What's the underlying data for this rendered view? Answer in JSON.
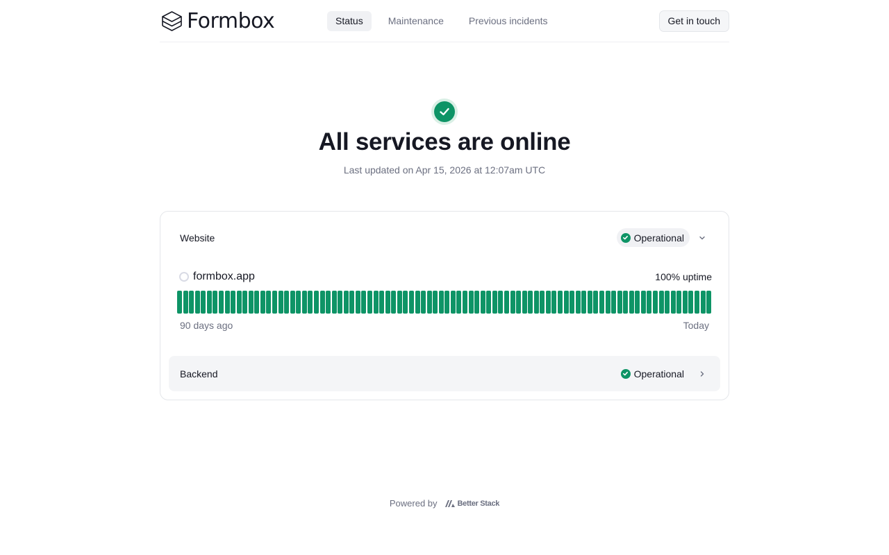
{
  "header": {
    "logo_text": "Formbox",
    "nav": [
      {
        "label": "Status",
        "active": true
      },
      {
        "label": "Maintenance",
        "active": false
      },
      {
        "label": "Previous incidents",
        "active": false
      }
    ],
    "contact_label": "Get in touch"
  },
  "hero": {
    "title": "All services are online",
    "updated": "Last updated on Apr 15, 2026 at 12:07am UTC"
  },
  "groups": [
    {
      "name": "Website",
      "status": "Operational",
      "expanded": true,
      "monitor": {
        "name": "formbox.app",
        "uptime": "100% uptime",
        "days": 90,
        "operational_days": 90,
        "start_label": "90 days ago",
        "end_label": "Today"
      }
    },
    {
      "name": "Backend",
      "status": "Operational",
      "expanded": false
    }
  ],
  "footer": {
    "powered_by": "Powered by",
    "brand": "Better Stack"
  },
  "colors": {
    "operational": "#0e9466",
    "text": "#161823",
    "muted": "#6b6f80"
  }
}
